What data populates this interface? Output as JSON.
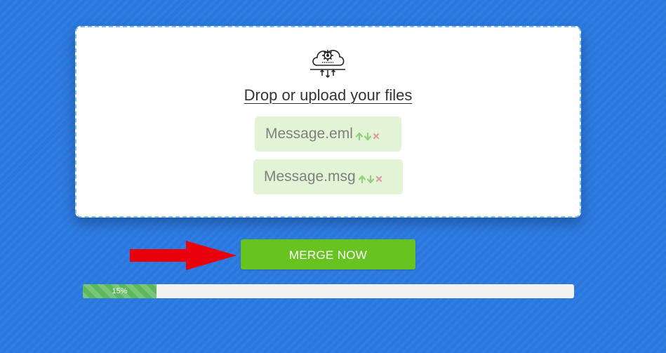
{
  "dropzone": {
    "label": "Drop or upload your files",
    "icon": "cloud-upload-gear-icon"
  },
  "files": [
    {
      "name": "Message.eml"
    },
    {
      "name": "Message.msg"
    }
  ],
  "file_actions": {
    "up_icon": "arrow-up-icon",
    "down_icon": "arrow-down-icon",
    "remove_icon": "remove-x-icon"
  },
  "annotation": {
    "icon": "red-arrow-pointer-icon"
  },
  "merge_button": {
    "label": "MERGE NOW"
  },
  "progress": {
    "value": 0.15,
    "text": "15%"
  },
  "colors": {
    "background": "#2a78df",
    "button": "#67c320",
    "progress_fill": "#5cb85c",
    "chip_bg": "#e2f3d6",
    "arrow": "#e8000b"
  }
}
